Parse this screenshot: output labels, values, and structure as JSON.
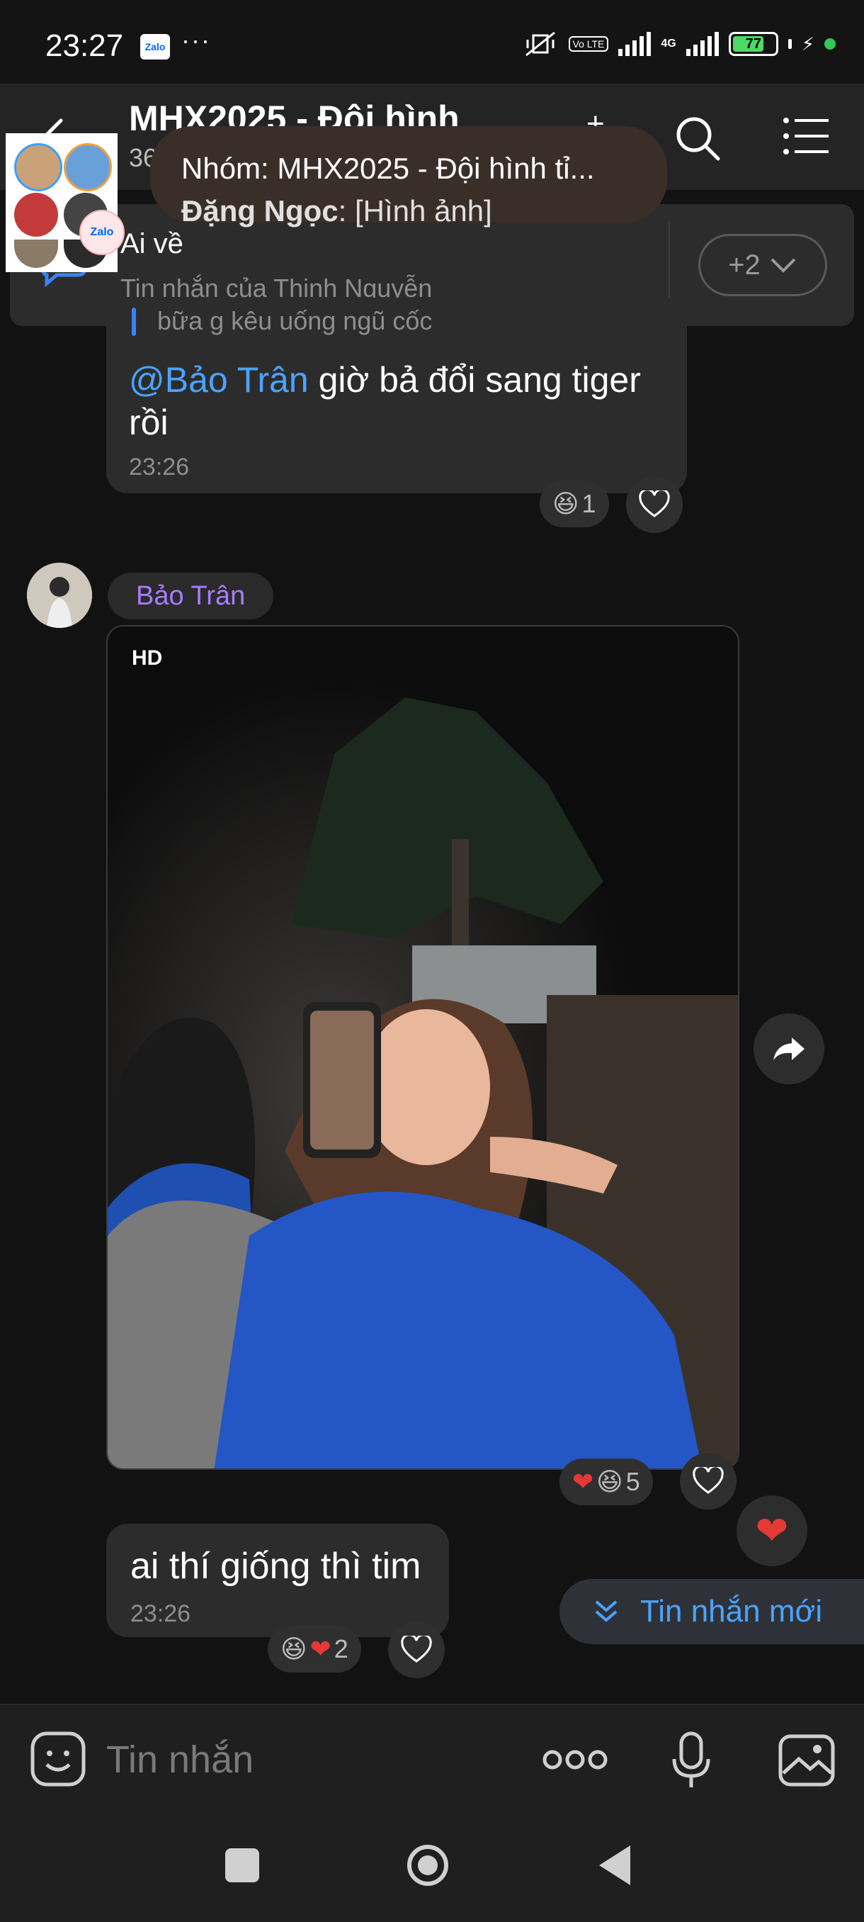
{
  "status_bar": {
    "time": "23:27",
    "app_badge": "Zalo",
    "overflow": "···",
    "volte": "Vo LTE",
    "network": "4G",
    "battery_level": "77",
    "battery_fraction": 0.77
  },
  "header": {
    "title": "MHX2025 - Đội hình",
    "subtitle": "36",
    "add_label": "+",
    "icons": [
      "back-arrow-icon",
      "search-icon",
      "menu-list-icon"
    ]
  },
  "pinned": {
    "text": "Ai về",
    "sub": "Tin nhắn của Thịnh Nguyễn",
    "more": "+2"
  },
  "notification": {
    "title": "Nhóm: MHX2025 - Đội hình tỉ...",
    "sender": "Đặng Ngọc",
    "body": ": [Hình ảnh]"
  },
  "messages": [
    {
      "quote": "bữa g kêu uống ngũ cốc",
      "mention": "@Bảo Trân",
      "text": " giờ bả đổi sang tiger rồi",
      "time": "23:26",
      "reaction_count": "1"
    },
    {
      "sender": "Bảo Trân",
      "badge": "HD",
      "reaction_count": "5"
    },
    {
      "text": "ai thí giống thì tim",
      "time": "23:26",
      "reaction_count": "2"
    }
  ],
  "new_messages": {
    "label": "Tin nhắn mới"
  },
  "input": {
    "placeholder": "Tin nhắn"
  },
  "colors": {
    "accent_blue": "#4aa3ff",
    "sender_purple": "#a97bff",
    "bubble": "#2c2c2c",
    "background": "#121212"
  }
}
